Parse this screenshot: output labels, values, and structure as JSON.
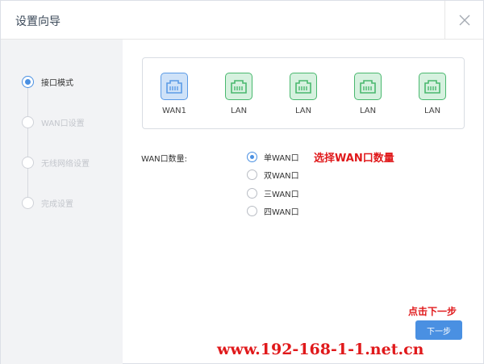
{
  "dialog": {
    "title": "设置向导",
    "close_icon": "close-icon"
  },
  "steps": [
    {
      "label": "接口模式",
      "active": true
    },
    {
      "label": "WAN口设置",
      "active": false
    },
    {
      "label": "无线网络设置",
      "active": false
    },
    {
      "label": "完成设置",
      "active": false
    }
  ],
  "ports": [
    {
      "label": "WAN1",
      "type": "wan",
      "icon": "ethernet-port-icon"
    },
    {
      "label": "LAN",
      "type": "lan",
      "icon": "ethernet-port-icon"
    },
    {
      "label": "LAN",
      "type": "lan",
      "icon": "ethernet-port-icon"
    },
    {
      "label": "LAN",
      "type": "lan",
      "icon": "ethernet-port-icon"
    },
    {
      "label": "LAN",
      "type": "lan",
      "icon": "ethernet-port-icon"
    }
  ],
  "wan_count": {
    "label": "WAN口数量:",
    "options": [
      {
        "label": "单WAN口",
        "checked": true
      },
      {
        "label": "双WAN口",
        "checked": false
      },
      {
        "label": "三WAN口",
        "checked": false
      },
      {
        "label": "四WAN口",
        "checked": false
      }
    ],
    "annotation": "选择WAN口数量"
  },
  "footer": {
    "annotation": "点击下一步",
    "next_label": "下一步"
  },
  "watermark": "www.192-168-1-1.net.cn",
  "colors": {
    "accent": "#4a90e2",
    "wan_port": "#5b9be6",
    "lan_port": "#49b86e",
    "annotation": "#e0191b"
  }
}
